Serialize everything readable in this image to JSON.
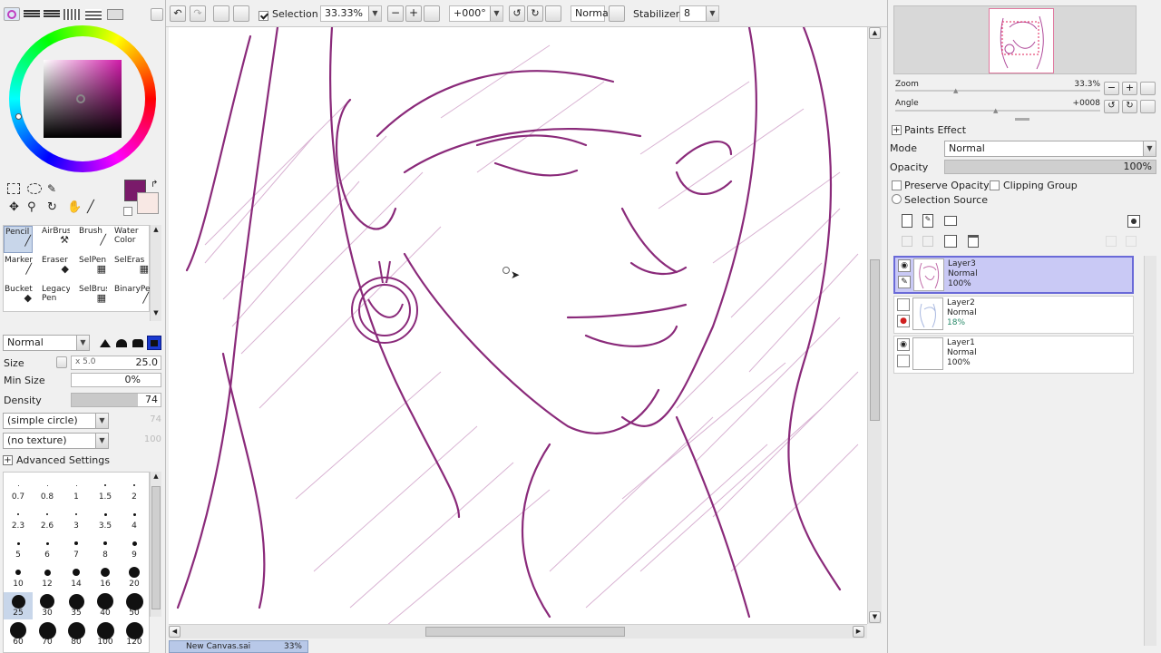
{
  "topbar": {
    "selection_label": "Selection",
    "zoom": "33.33%",
    "angle": "+000°",
    "blend_mode": "Normal",
    "stabilizer_label": "Stabilizer",
    "stabilizer_value": "8"
  },
  "tools": {
    "row1": [
      "Pencil",
      "AirBrush",
      "Brush",
      "Water Color"
    ],
    "row2": [
      "Marker",
      "Eraser",
      "SelPen",
      "SelEras"
    ],
    "row3": [
      "Bucket",
      "Legacy Pen",
      "SelBrush",
      "BinaryPe"
    ]
  },
  "brush": {
    "mode": "Normal",
    "size_label": "Size",
    "size_mult": "x 5.0",
    "size_value": "25.0",
    "min_size_label": "Min Size",
    "min_size_value": "0%",
    "density_label": "Density",
    "density_value": "74",
    "density_fraction": 0.74,
    "shape": "(simple circle)",
    "shape_value": "74",
    "texture": "(no texture)",
    "texture_value": "100",
    "advanced_label": "Advanced Settings"
  },
  "brush_sizes": {
    "row1": [
      "0.7",
      "0.8",
      "1",
      "1.5",
      "2"
    ],
    "row2": [
      "2.3",
      "2.6",
      "3",
      "3.5",
      "4"
    ],
    "row3": [
      "5",
      "6",
      "7",
      "8",
      "9"
    ],
    "row4": [
      "10",
      "12",
      "14",
      "16",
      "20"
    ],
    "row5": [
      "25",
      "30",
      "35",
      "40",
      "50"
    ],
    "row6": [
      "60",
      "70",
      "80",
      "100",
      "120"
    ]
  },
  "navigator": {
    "zoom_label": "Zoom",
    "zoom_value": "33.3%",
    "angle_label": "Angle",
    "angle_value": "+0008"
  },
  "layer_props": {
    "paints_effect": "Paints Effect",
    "mode_label": "Mode",
    "mode_value": "Normal",
    "opacity_label": "Opacity",
    "opacity_value": "100%",
    "preserve_opacity": "Preserve Opacity",
    "clipping_group": "Clipping Group",
    "selection_source": "Selection Source"
  },
  "layers": [
    {
      "name": "Layer3",
      "mode": "Normal",
      "opacity": "100%"
    },
    {
      "name": "Layer2",
      "mode": "Normal",
      "opacity": "18%"
    },
    {
      "name": "Layer1",
      "mode": "Normal",
      "opacity": "100%"
    }
  ],
  "status": {
    "document": "New Canvas.sai",
    "zoom": "33%"
  },
  "colors": {
    "primary": "#7a1a6a",
    "secondary": "#f8e8e4",
    "stroke": "#8a2a7a"
  }
}
